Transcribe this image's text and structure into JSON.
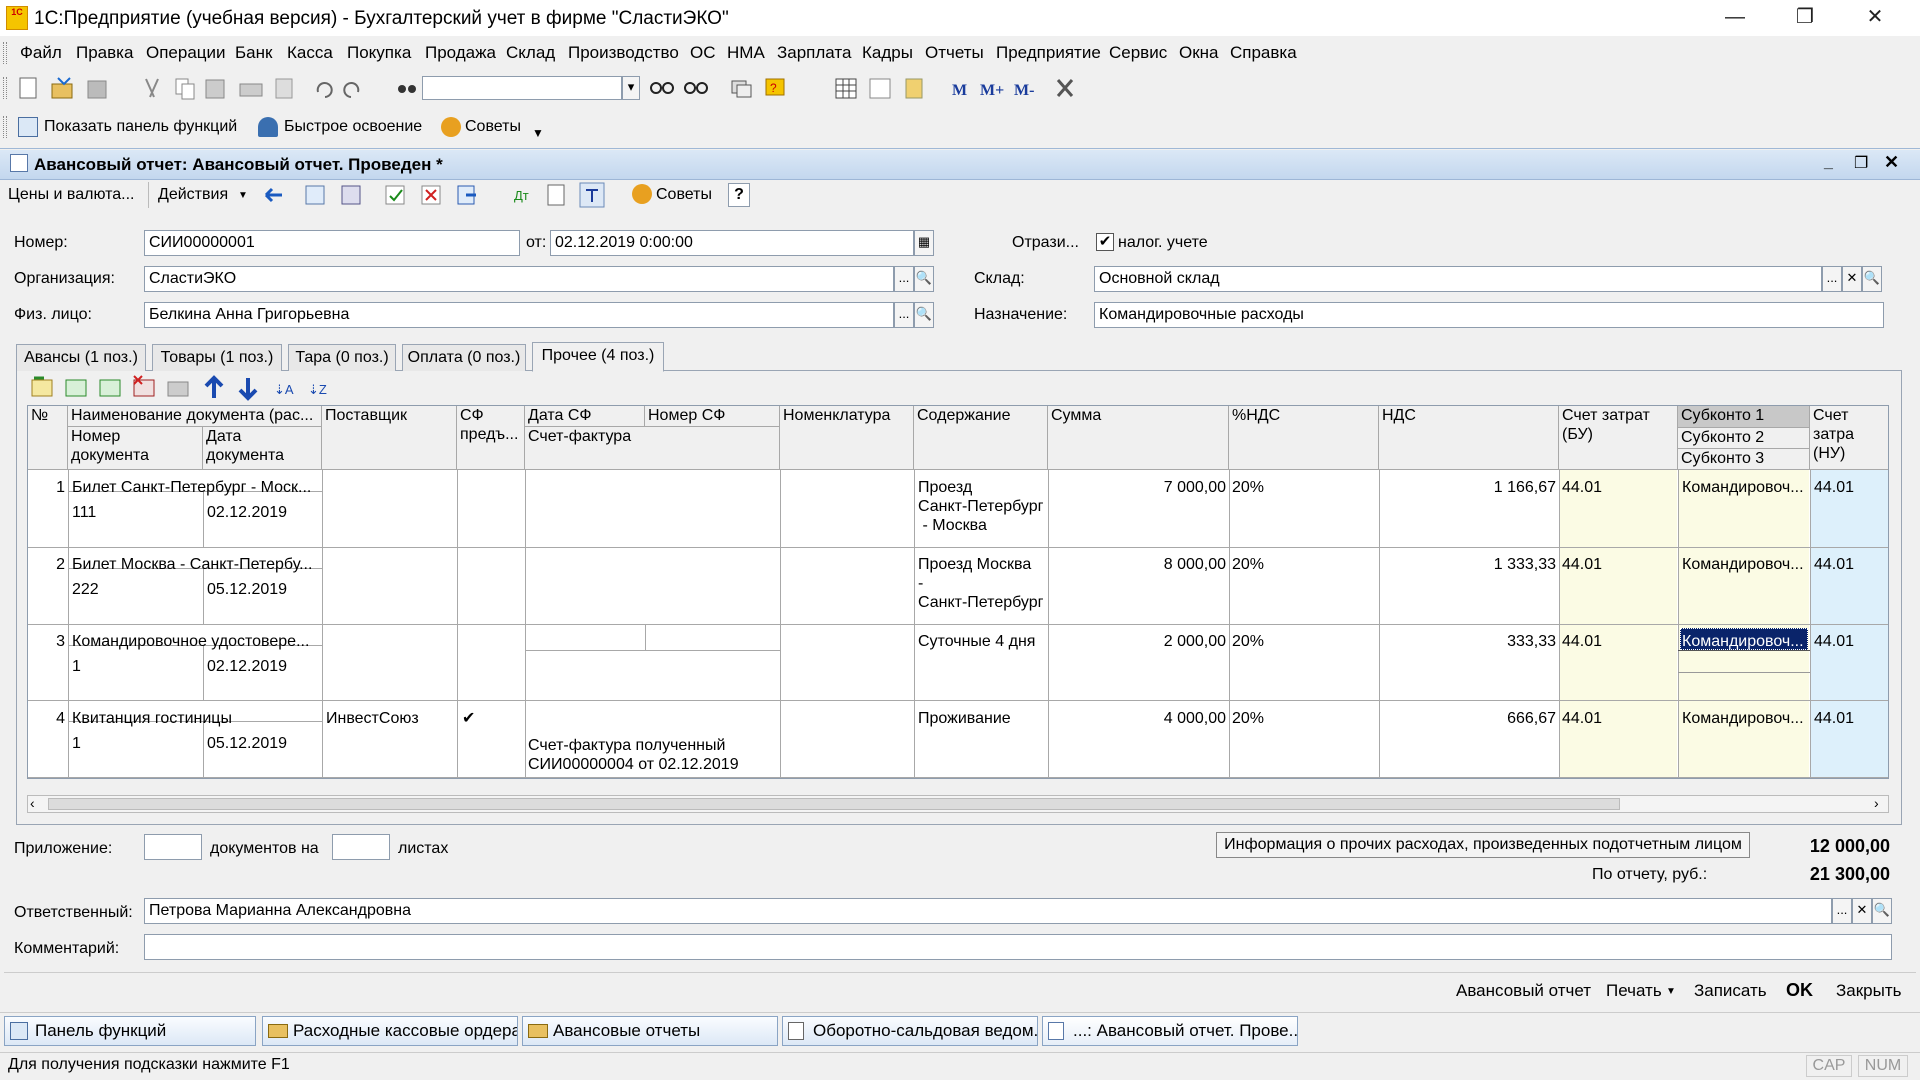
{
  "window": {
    "logo": "1С",
    "title": "1С:Предприятие (учебная версия) - Бухгалтерский учет в фирме \"СластиЭКО\""
  },
  "menu": [
    "Файл",
    "Правка",
    "Операции",
    "Банк",
    "Касса",
    "Покупка",
    "Продажа",
    "Склад",
    "Производство",
    "ОС",
    "НМА",
    "Зарплата",
    "Кадры",
    "Отчеты",
    "Предприятие",
    "Сервис",
    "Окна",
    "Справка"
  ],
  "toolbar2": {
    "show_panel": "Показать панель функций",
    "quick_learn": "Быстрое освоение",
    "tips": "Советы"
  },
  "doc": {
    "title": "Авансовый отчет: Авансовый отчет. Проведен *",
    "toolbar": {
      "prices": "Цены и валюта...",
      "actions": "Действия",
      "tips": "Советы",
      "help": "?"
    },
    "labels": {
      "number": "Номер:",
      "from": "от:",
      "org": "Организация:",
      "person": "Физ. лицо:",
      "reflect": "Отрази...",
      "tax": "налог. учете",
      "warehouse": "Склад:",
      "purpose": "Назначение:"
    },
    "values": {
      "number": "СИИ00000001",
      "date": "02.12.2019  0:00:00",
      "org": "СластиЭКО",
      "person": "Белкина Анна Григорьевна",
      "warehouse": "Основной склад",
      "purpose": "Командировочные расходы"
    },
    "tabs": [
      "Авансы (1 поз.)",
      "Товары (1 поз.)",
      "Тара (0 поз.)",
      "Оплата (0 поз.)",
      "Прочее (4 поз.)"
    ],
    "grid": {
      "headers": {
        "n": "№",
        "docname": "Наименование документа (рас...",
        "docnum": "Номер документа",
        "docdate": "Дата документа",
        "supplier": "Поставщик",
        "sf": "СФ предъ...",
        "sfdate": "Дата СФ",
        "sfnum": "Номер СФ",
        "invoice": "Счет-фактура",
        "nomen": "Номенклатура",
        "content": "Содержание",
        "sum": "Сумма",
        "vatpct": "%НДС",
        "vat": "НДС",
        "acc_bu": "Счет затрат (БУ)",
        "sub1": "Субконто 1",
        "sub2": "Субконто 2",
        "sub3": "Субконто 3",
        "acc_nu": "Счет затра (НУ)"
      },
      "rows": [
        {
          "n": "1",
          "name": "Билет Санкт-Петербург - Моск...",
          "num": "111",
          "date": "02.12.2019",
          "supplier": "",
          "sf": "",
          "invoice": "",
          "content": [
            "Проезд",
            "Санкт-Петербург",
            " - Москва"
          ],
          "sum": "7 000,00",
          "vatpct": "20%",
          "vat": "1 166,67",
          "acc": "44.01",
          "sub1": "Командировоч...",
          "accnu": "44.01"
        },
        {
          "n": "2",
          "name": "Билет Москва - Санкт-Петербу...",
          "num": "222",
          "date": "05.12.2019",
          "supplier": "",
          "sf": "",
          "invoice": "",
          "content": [
            "Проезд Москва",
            "-",
            "Санкт-Петербург"
          ],
          "sum": "8 000,00",
          "vatpct": "20%",
          "vat": "1 333,33",
          "acc": "44.01",
          "sub1": "Командировоч...",
          "accnu": "44.01"
        },
        {
          "n": "3",
          "name": "Командировочное удостовере...",
          "num": "1",
          "date": "02.12.2019",
          "supplier": "",
          "sf": "",
          "invoice": "",
          "content": [
            "Суточные 4 дня"
          ],
          "sum": "2 000,00",
          "vatpct": "20%",
          "vat": "333,33",
          "acc": "44.01",
          "sub1": "Командировоч...",
          "accnu": "44.01"
        },
        {
          "n": "4",
          "name": "Квитанция гостиницы",
          "num": "1",
          "date": "05.12.2019",
          "supplier": "ИнвестСоюз",
          "sf": "✔",
          "invoice": "Счет-фактура полученный СИИ00000004 от 02.12.2019",
          "content": [
            "Проживание"
          ],
          "sum": "4 000,00",
          "vatpct": "20%",
          "vat": "666,67",
          "acc": "44.01",
          "sub1": "Командировоч...",
          "accnu": "44.01"
        }
      ]
    },
    "bottom": {
      "attach": "Приложение:",
      "docs_on": "документов на",
      "sheets": "листах",
      "info_button": "Информация о прочих расходах, произведенных подотчетным лицом",
      "total_other": "12 000,00",
      "report_label": "По отчету, руб.:",
      "report_total": "21 300,00",
      "responsible_label": "Ответственный:",
      "responsible": "Петрова Марианна Александровна",
      "comment_label": "Комментарий:",
      "comment": ""
    },
    "actions": {
      "report": "Авансовый отчет",
      "print": "Печать",
      "save": "Записать",
      "ok": "OK",
      "close": "Закрыть"
    }
  },
  "taskbar": [
    "Панель функций",
    "Расходные кассовые ордера",
    "Авансовые отчеты",
    "Оборотно-сальдовая ведом...",
    "...: Авансовый отчет. Прове..."
  ],
  "status": {
    "hint": "Для получения подсказки нажмите F1",
    "cap": "CAP",
    "num": "NUM"
  }
}
